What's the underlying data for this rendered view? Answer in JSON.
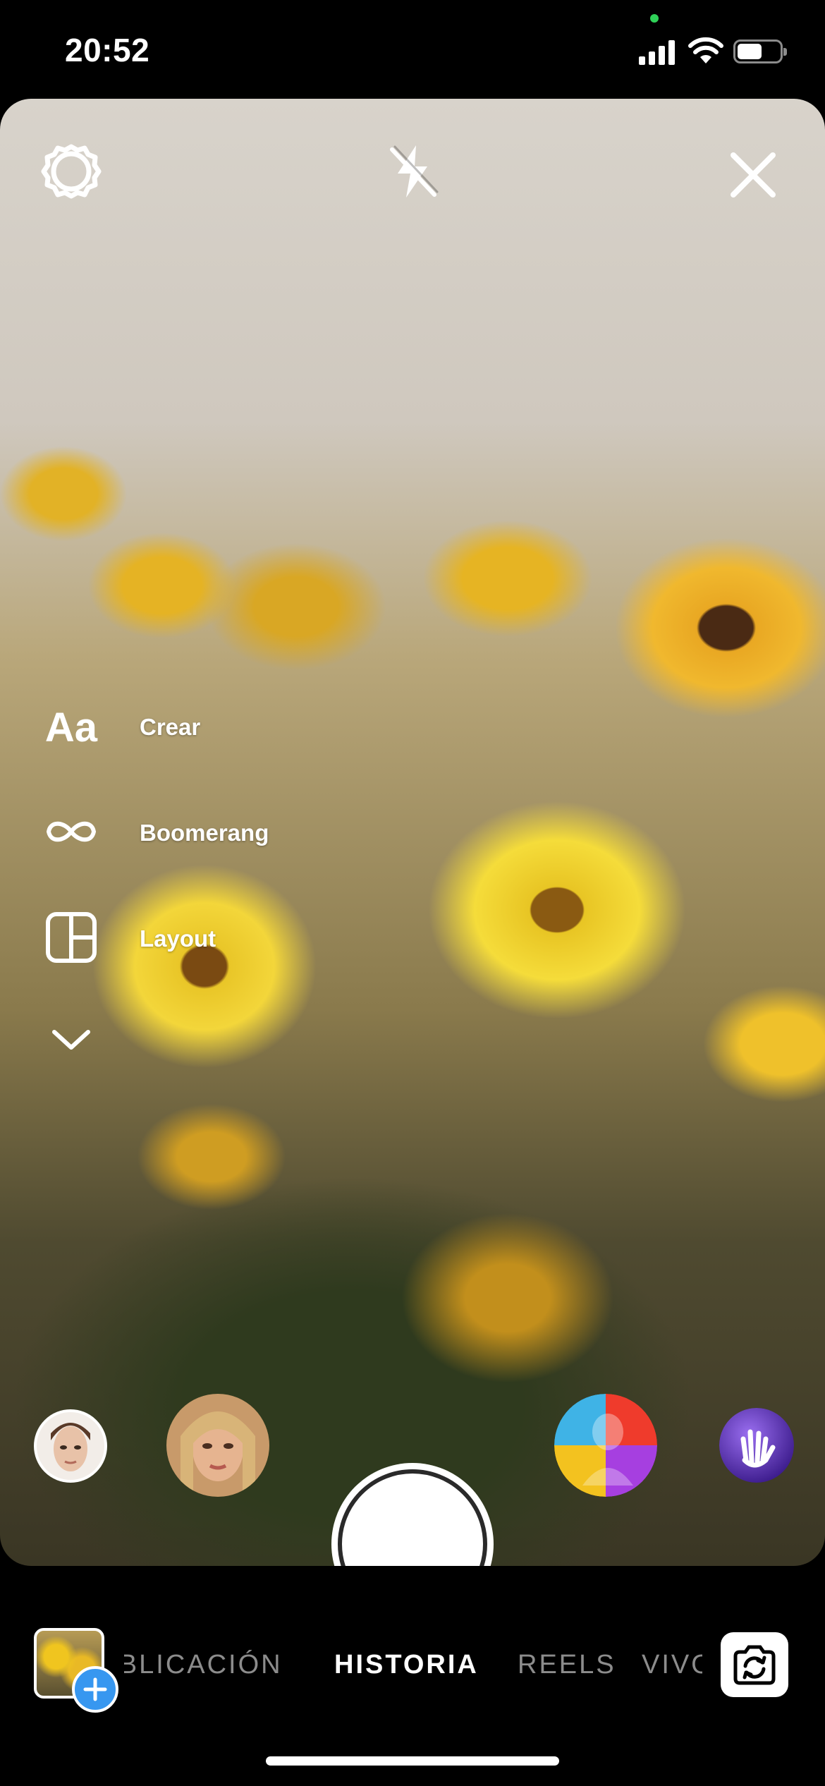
{
  "status_bar": {
    "time": "20:52",
    "icons": [
      "signal-icon",
      "wifi-icon",
      "battery-icon"
    ]
  },
  "camera_top": {
    "icons": [
      "settings-gear-icon",
      "flash-off-icon",
      "close-icon"
    ]
  },
  "modes": {
    "items": [
      {
        "icon_text": "Aa",
        "label": "Crear"
      },
      {
        "icon": "infinity-icon",
        "label": "Boomerang"
      },
      {
        "icon": "layout-grid-icon",
        "label": "Layout"
      }
    ],
    "more_icon": "chevron-down-icon"
  },
  "effects": {
    "items": [
      "face-effect-avatar-1",
      "face-effect-avatar-2",
      "shutter-button",
      "color-face-effect",
      "waving-hand-effect"
    ]
  },
  "bottom_tabs": {
    "items": [
      "PUBLICACIÓN",
      "HISTORIA",
      "REELS",
      "VIVO"
    ],
    "active": "HISTORIA"
  },
  "colors": {
    "accent_blue": "#3797f0",
    "status_green": "#2fd158"
  }
}
